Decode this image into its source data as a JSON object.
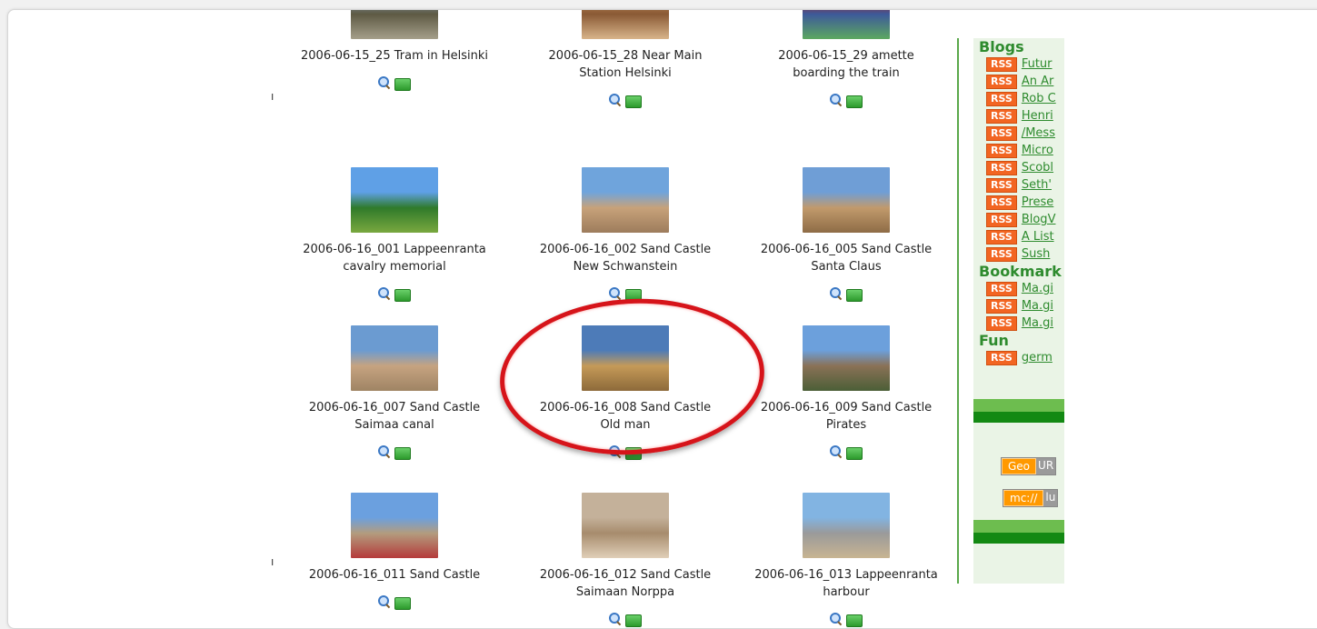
{
  "gallery": {
    "items": [
      {
        "caption_line1": "2006-06-15_25 Tram in Helsinki",
        "caption_line2": "",
        "thumb": [
          "#7c8fa3",
          "#5e5a44",
          "#a59f8a"
        ]
      },
      {
        "caption_line1": "2006-06-15_28 Near Main",
        "caption_line2": "Station Helsinki",
        "thumb": [
          "#b58452",
          "#8a5a35",
          "#d8b48a"
        ]
      },
      {
        "caption_line1": "2006-06-15_29 amette",
        "caption_line2": "boarding the train",
        "thumb": [
          "#a31818",
          "#3d5a9a",
          "#5ca860"
        ]
      },
      {
        "caption_line1": "2006-06-16_001 Lappeenranta",
        "caption_line2": "cavalry memorial",
        "thumb": [
          "#5fa0e6",
          "#2f7a2a",
          "#7aa83f"
        ]
      },
      {
        "caption_line1": "2006-06-16_002 Sand Castle",
        "caption_line2": "New Schwanstein",
        "thumb": [
          "#6fa4dc",
          "#c7a27a",
          "#9d7c5c"
        ]
      },
      {
        "caption_line1": "2006-06-16_005 Sand Castle",
        "caption_line2": "Santa Claus",
        "thumb": [
          "#6f9ed6",
          "#c19a6c",
          "#8e6c46"
        ]
      },
      {
        "caption_line1": "2006-06-16_007 Sand Castle",
        "caption_line2": "Saimaa canal",
        "thumb": [
          "#6b9bd1",
          "#c6a380",
          "#9f8464"
        ]
      },
      {
        "caption_line1": "2006-06-16_008 Sand Castle",
        "caption_line2": "Old man",
        "thumb": [
          "#4d7bb8",
          "#c59a58",
          "#8d6a3a"
        ]
      },
      {
        "caption_line1": "2006-06-16_009 Sand Castle",
        "caption_line2": "Pirates",
        "thumb": [
          "#6ca0dc",
          "#8a7156",
          "#4b5f37"
        ]
      },
      {
        "caption_line1": "2006-06-16_011 Sand Castle",
        "caption_line2": "",
        "thumb": [
          "#6ba0df",
          "#b39c7e",
          "#b53a3a"
        ]
      },
      {
        "caption_line1": "2006-06-16_012 Sand Castle",
        "caption_line2": "Saimaan Norppa",
        "thumb": [
          "#c4b19a",
          "#a78c6d",
          "#e0cfb8"
        ]
      },
      {
        "caption_line1": "2006-06-16_013 Lappeenranta",
        "caption_line2": "harbour",
        "thumb": [
          "#82b4e2",
          "#9a9a9a",
          "#c8b492"
        ]
      }
    ]
  },
  "sidebar": {
    "blogs_heading": "Blogs",
    "badge": "RSS",
    "blogs": [
      "Futur",
      "An Ar",
      "Rob C",
      "Henri",
      "/Mess",
      "Micro",
      "Scobl",
      "Seth'",
      "Prese",
      "BlogV",
      "A List",
      "Sush"
    ],
    "bookmarks_heading": "Bookmark",
    "bookmarks": [
      "Ma.gi",
      "Ma.gi",
      "Ma.gi"
    ],
    "fun_heading": "Fun",
    "fun": [
      "germ"
    ],
    "geo_left": "Geo",
    "geo_right": "UR",
    "mc_left": "mc://",
    "mc_right": "lu"
  },
  "colors": {
    "accent_green": "#2e8b2e",
    "rss_orange": "#f26522",
    "annotation_red": "#d6141a"
  }
}
